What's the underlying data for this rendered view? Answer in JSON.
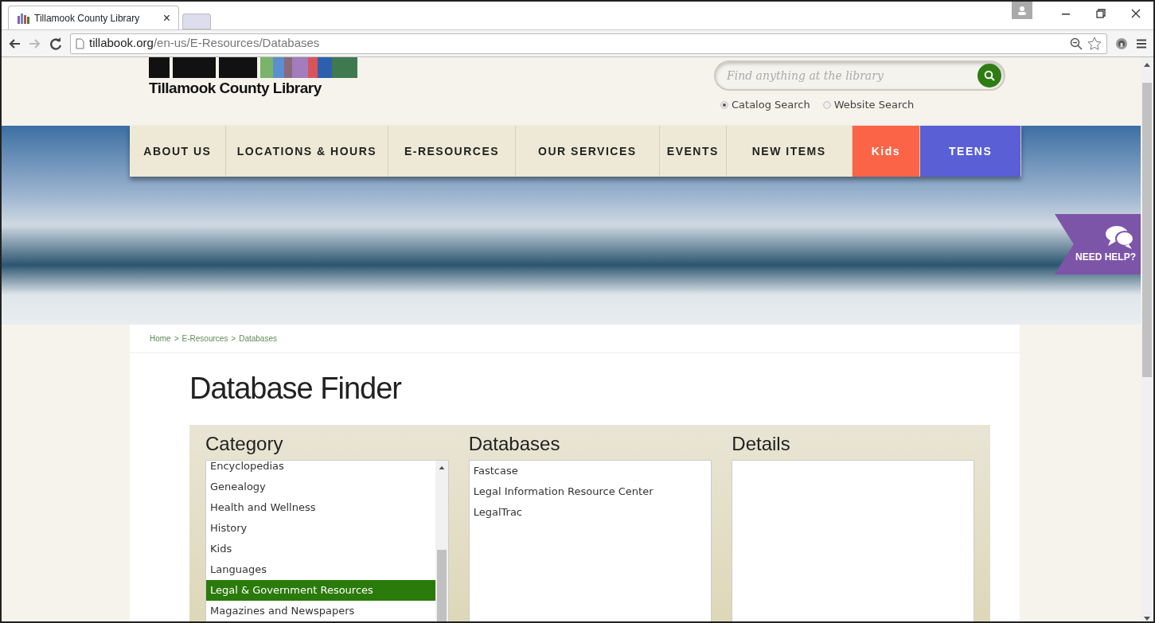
{
  "browser": {
    "tab_title": "Tillamook County Library",
    "tab_close": "×",
    "url_host": "tillabook.org",
    "url_path": "/en-us/E-Resources/Databases"
  },
  "header": {
    "logo_text": "Tillamook County Library",
    "search": {
      "placeholder": "Find anything at the library"
    },
    "search_modes": [
      {
        "label": "Catalog Search",
        "selected": true
      },
      {
        "label": "Website Search",
        "selected": false
      }
    ]
  },
  "nav": [
    {
      "label": "ABOUT US",
      "color": "#ede9d6"
    },
    {
      "label": "LOCATIONS & HOURS",
      "color": "#ede9d6"
    },
    {
      "label": "E-RESOURCES",
      "color": "#ede9d6"
    },
    {
      "label": "OUR SERVICES",
      "color": "#ede9d6"
    },
    {
      "label": "EVENTS",
      "color": "#ede9d6"
    },
    {
      "label": "NEW ITEMS",
      "color": "#ede9d6"
    },
    {
      "label": "Kids",
      "color": "#fb6446"
    },
    {
      "label": "TEENS",
      "color": "#5a5fd6"
    }
  ],
  "help_badge": "NEED HELP?",
  "breadcrumb": {
    "separator": ">",
    "items": [
      "Home",
      "E-Resources",
      "Databases"
    ]
  },
  "page_title": "Database Finder",
  "finder": {
    "category": {
      "heading": "Category",
      "items": [
        {
          "label": "Encyclopedias",
          "selected": false
        },
        {
          "label": "Genealogy",
          "selected": false
        },
        {
          "label": "Health and Wellness",
          "selected": false
        },
        {
          "label": "History",
          "selected": false
        },
        {
          "label": "Kids",
          "selected": false
        },
        {
          "label": "Languages",
          "selected": false
        },
        {
          "label": "Legal & Government Resources",
          "selected": true
        },
        {
          "label": "Magazines and Newspapers",
          "selected": false
        }
      ]
    },
    "databases": {
      "heading": "Databases",
      "items": [
        {
          "label": "Fastcase",
          "selected": false
        },
        {
          "label": "Legal Information Resource Center",
          "selected": false
        },
        {
          "label": "LegalTrac",
          "selected": false
        }
      ]
    },
    "details": {
      "heading": "Details"
    }
  }
}
